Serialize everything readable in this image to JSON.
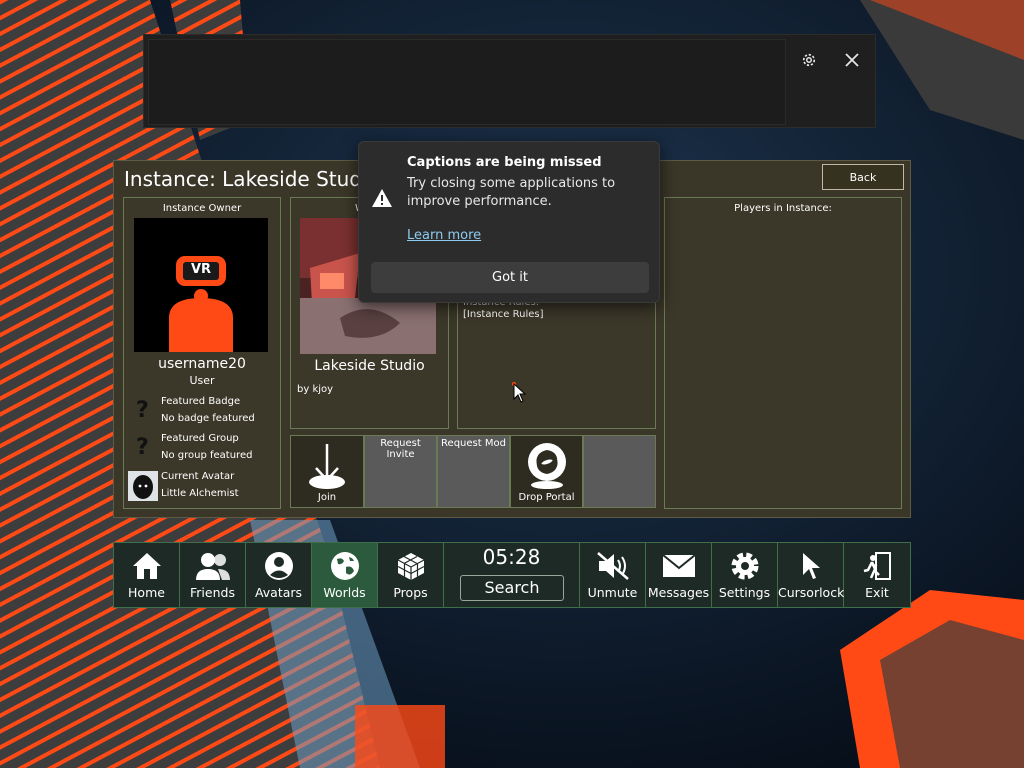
{
  "caption_bar": {
    "settings_icon": "gear-icon",
    "close_icon": "close-icon"
  },
  "panel": {
    "title": "Instance: Lakeside Studio (",
    "back_label": "Back",
    "owner": {
      "header": "Instance Owner",
      "username": "username20",
      "role": "User",
      "avatar_text": "VR",
      "badge_label": "Featured Badge",
      "badge_value": "No badge featured",
      "group_label": "Featured Group",
      "group_value": "No group featured",
      "avatar_label": "Current Avatar",
      "avatar_value": "Little Alchemist"
    },
    "world": {
      "header": "W",
      "name": "Lakeside Studio",
      "author": "by kjoy"
    },
    "rules": {
      "header": "Instance Rules:",
      "value": "[Instance Rules]"
    },
    "actions": {
      "join": "Join",
      "request_invite": "Request Invite",
      "request_mod": "Request Mod",
      "drop_portal": "Drop Portal"
    },
    "players_header": "Players in Instance:"
  },
  "toast": {
    "title": "Captions are being missed",
    "body": "Try closing some applications to improve performance.",
    "link": "Learn more",
    "button": "Got it"
  },
  "menubar": {
    "home": "Home",
    "friends": "Friends",
    "avatars": "Avatars",
    "worlds": "Worlds",
    "props": "Props",
    "time": "05:28",
    "search": "Search",
    "unmute": "Unmute",
    "messages": "Messages",
    "settings": "Settings",
    "cursorlock": "Cursorlock",
    "exit": "Exit"
  },
  "colors": {
    "accent_orange": "#ff4a16",
    "menu_active": "#2b5b3c",
    "panel_bg": "#3a3628"
  }
}
